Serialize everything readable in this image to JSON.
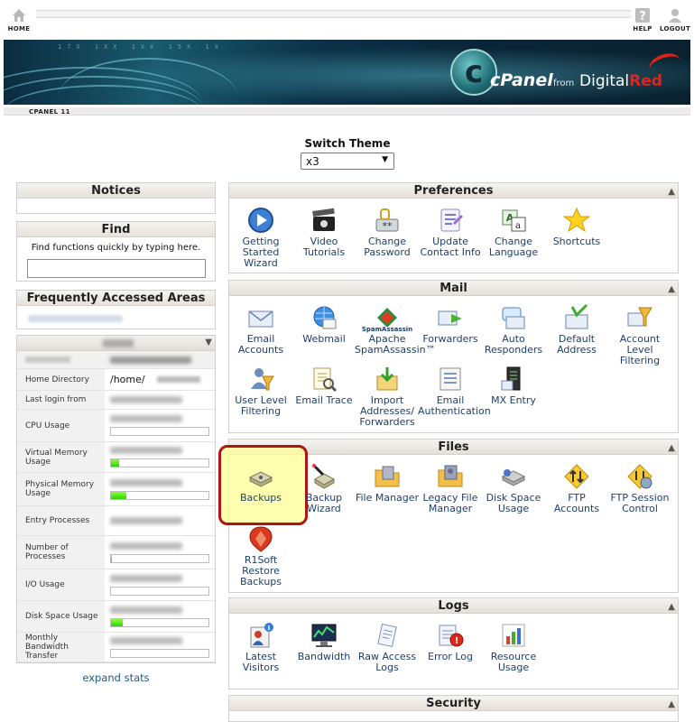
{
  "topnav": {
    "home": "HOME",
    "help": "HELP",
    "logout": "LOGOUT"
  },
  "banner": {
    "logo_letter": "c",
    "product": "cPanel",
    "from": "from",
    "brand_a": "Digital",
    "brand_b": "Red"
  },
  "version": "CPANEL 11",
  "theme": {
    "label": "Switch Theme",
    "selected": "x3"
  },
  "notices": {
    "title": "Notices"
  },
  "find": {
    "title": "Find",
    "hint": "Find functions quickly by typing here.",
    "placeholder": ""
  },
  "faa": {
    "title": "Frequently Accessed Areas"
  },
  "stats": {
    "rows": [
      {
        "label": "Home Directory",
        "value": "/home/"
      },
      {
        "label": "Last login from"
      },
      {
        "label": "CPU Usage",
        "fill": 0
      },
      {
        "label": "Virtual Memory Usage",
        "fill": 0.08
      },
      {
        "label": "Physical Memory Usage",
        "fill": 0.16
      },
      {
        "label": "Entry Processes"
      },
      {
        "label": "Number of Processes",
        "fill": 0.01
      },
      {
        "label": "I/O Usage",
        "fill": 0
      },
      {
        "label": "Disk Space Usage",
        "fill": 0.12
      },
      {
        "label": "Monthly Bandwidth Transfer",
        "fill": 0
      }
    ],
    "expand": "expand stats"
  },
  "preferences": {
    "title": "Preferences",
    "items": [
      {
        "label": "Getting Started Wizard",
        "icon": "play-icon"
      },
      {
        "label": "Video Tutorials",
        "icon": "clapper-icon"
      },
      {
        "label": "Change Password",
        "icon": "password-icon"
      },
      {
        "label": "Update Contact Info",
        "icon": "contact-icon"
      },
      {
        "label": "Change Language",
        "icon": "language-icon"
      },
      {
        "label": "Shortcuts",
        "icon": "star-icon"
      }
    ]
  },
  "mail": {
    "title": "Mail",
    "items": [
      {
        "label": "Email Accounts",
        "icon": "envelope-icon"
      },
      {
        "label": "Webmail",
        "icon": "globe-mail-icon"
      },
      {
        "label": "Apache SpamAssassin™",
        "icon": "spamassassin-icon",
        "logo_text": "SpamAssassin"
      },
      {
        "label": "Forwarders",
        "icon": "forward-icon"
      },
      {
        "label": "Auto Responders",
        "icon": "autoresponder-icon"
      },
      {
        "label": "Default Address",
        "icon": "default-address-icon"
      },
      {
        "label": "Account Level Filtering",
        "icon": "filter-icon"
      },
      {
        "label": "User Level Filtering",
        "icon": "user-filter-icon"
      },
      {
        "label": "Email Trace",
        "icon": "trace-icon"
      },
      {
        "label": "Import Addresses/ Forwarders",
        "icon": "import-icon"
      },
      {
        "label": "Email Authentication",
        "icon": "auth-icon"
      },
      {
        "label": "MX Entry",
        "icon": "mx-icon"
      }
    ]
  },
  "files": {
    "title": "Files",
    "items": [
      {
        "label": "Backups",
        "icon": "backup-icon"
      },
      {
        "label": "Backup Wizard",
        "icon": "backup-wizard-icon"
      },
      {
        "label": "File Manager",
        "icon": "folder-icon"
      },
      {
        "label": "Legacy File Manager",
        "icon": "legacy-folder-icon"
      },
      {
        "label": "Disk Space Usage",
        "icon": "disk-icon"
      },
      {
        "label": "FTP Accounts",
        "icon": "ftp-icon"
      },
      {
        "label": "FTP Session Control",
        "icon": "ftp-session-icon"
      },
      {
        "label": "R1Soft Restore Backups",
        "icon": "r1soft-icon"
      }
    ]
  },
  "logs": {
    "title": "Logs",
    "items": [
      {
        "label": "Latest Visitors",
        "icon": "visitors-icon"
      },
      {
        "label": "Bandwidth",
        "icon": "bandwidth-icon"
      },
      {
        "label": "Raw Access Logs",
        "icon": "rawlog-icon"
      },
      {
        "label": "Error Log",
        "icon": "errorlog-icon"
      },
      {
        "label": "Resource Usage",
        "icon": "resource-icon"
      }
    ]
  },
  "security": {
    "title": "Security"
  },
  "colors": {
    "accent": "#1e3f6e",
    "highlight_border": "#b01515",
    "highlight_fill": "#ffff96",
    "bar_fill": "#2bd400"
  }
}
